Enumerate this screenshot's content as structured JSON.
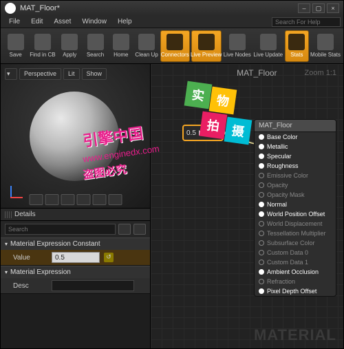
{
  "window": {
    "title": "MAT_Floor*"
  },
  "menu": {
    "items": [
      "File",
      "Edit",
      "Asset",
      "Window",
      "Help"
    ],
    "search_placeholder": "Search For Help"
  },
  "toolbar": {
    "buttons": [
      {
        "label": "Save",
        "active": false
      },
      {
        "label": "Find in CB",
        "active": false
      },
      {
        "label": "Apply",
        "active": false
      },
      {
        "label": "Search",
        "active": false
      },
      {
        "label": "Home",
        "active": false
      },
      {
        "label": "Clean Up",
        "active": false
      },
      {
        "label": "Connectors",
        "active": true
      },
      {
        "label": "Live Preview",
        "active": true
      },
      {
        "label": "Live Nodes",
        "active": false
      },
      {
        "label": "Live Update",
        "active": false
      },
      {
        "label": "Stats",
        "active": true
      },
      {
        "label": "Mobile Stats",
        "active": false
      }
    ]
  },
  "viewport": {
    "buttons": [
      "Perspective",
      "Lit",
      "Show"
    ]
  },
  "details": {
    "header": "Details",
    "search_placeholder": "Search",
    "sections": {
      "const": {
        "title": "Material Expression Constant",
        "value_label": "Value",
        "value": "0.5"
      },
      "expr": {
        "title": "Material Expression",
        "desc_label": "Desc",
        "desc": ""
      }
    }
  },
  "graph": {
    "title": "MAT_Floor",
    "zoom": "Zoom 1:1",
    "watermark": "MATERIAL",
    "const_value": "0.5",
    "mat_node": {
      "title": "MAT_Floor",
      "pins": [
        {
          "label": "Base Color",
          "on": true
        },
        {
          "label": "Metallic",
          "on": true
        },
        {
          "label": "Specular",
          "on": true
        },
        {
          "label": "Roughness",
          "on": true
        },
        {
          "label": "Emissive Color",
          "on": false
        },
        {
          "label": "Opacity",
          "on": false
        },
        {
          "label": "Opacity Mask",
          "on": false
        },
        {
          "label": "Normal",
          "on": true
        },
        {
          "label": "World Position Offset",
          "on": true
        },
        {
          "label": "World Displacement",
          "on": false
        },
        {
          "label": "Tessellation Multiplier",
          "on": false
        },
        {
          "label": "Subsurface Color",
          "on": false
        },
        {
          "label": "Custom Data 0",
          "on": false
        },
        {
          "label": "Custom Data 1",
          "on": false
        },
        {
          "label": "Ambient Occlusion",
          "on": true
        },
        {
          "label": "Refraction",
          "on": false
        },
        {
          "label": "Pixel Depth Offset",
          "on": true
        }
      ]
    }
  },
  "overlay": {
    "cn1": "引擎中国",
    "url": "www.enginedx.com",
    "cn2": "盗图必究",
    "boxes": [
      "实",
      "物",
      "拍",
      "摄"
    ]
  }
}
